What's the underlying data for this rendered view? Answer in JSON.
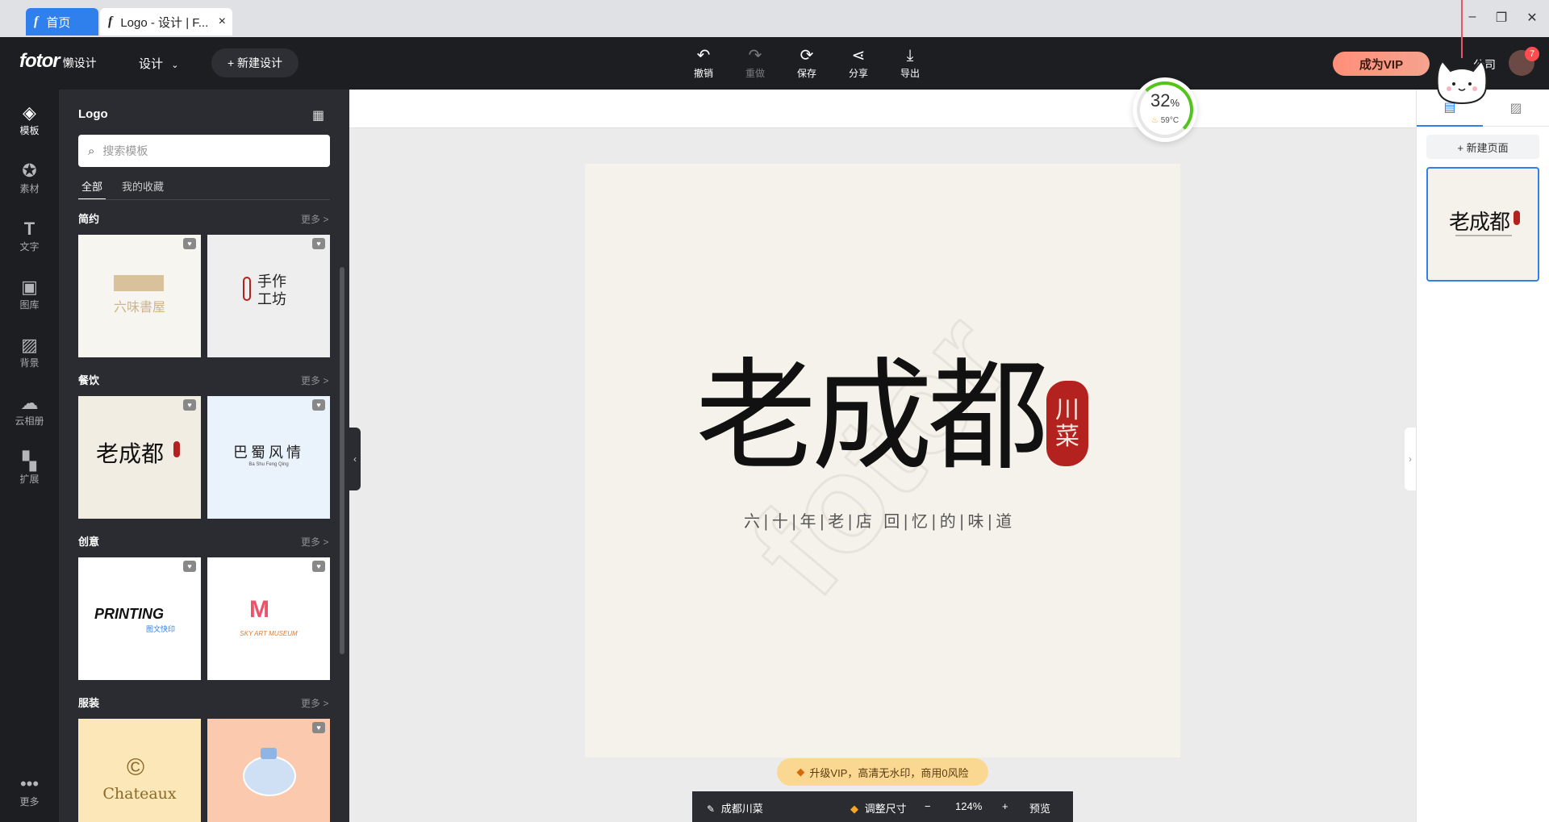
{
  "window": {
    "tabs": [
      {
        "icon": "f",
        "label": "首页"
      },
      {
        "icon": "f",
        "label": "Logo - 设计 | F..."
      }
    ],
    "close_tab": "×",
    "controls": {
      "minimize": "–",
      "restore": "❐",
      "close": "✕"
    }
  },
  "topbar": {
    "brand": "fotor",
    "brand_sub": "懒设计",
    "design_menu": "设计",
    "new_design": "+ 新建设计",
    "tools": [
      {
        "icon": "undo-icon",
        "label": "撤销",
        "disabled": false
      },
      {
        "icon": "redo-icon",
        "label": "重做",
        "disabled": true
      },
      {
        "icon": "save-icon",
        "label": "保存",
        "disabled": false
      },
      {
        "icon": "share-icon",
        "label": "分享",
        "disabled": false
      },
      {
        "icon": "export-icon",
        "label": "导出",
        "disabled": false
      }
    ],
    "vip_button": "成为VIP",
    "company_text": "公司",
    "avatar_badge": "7"
  },
  "rail": [
    {
      "icon": "layers-icon",
      "label": "模板",
      "active": true
    },
    {
      "icon": "star-icon",
      "label": "素材",
      "active": false
    },
    {
      "icon": "text-icon",
      "label": "文字",
      "active": false
    },
    {
      "icon": "image-icon",
      "label": "图库",
      "active": false
    },
    {
      "icon": "background-icon",
      "label": "背景",
      "active": false
    },
    {
      "icon": "cloud-icon",
      "label": "云相册",
      "active": false
    },
    {
      "icon": "extend-icon",
      "label": "扩展",
      "active": false
    },
    {
      "icon": "more-icon",
      "label": "更多",
      "active": false
    }
  ],
  "panel": {
    "title": "Logo",
    "search_placeholder": "搜索模板",
    "subtabs": [
      "全部",
      "我的收藏"
    ],
    "sections": [
      {
        "title": "简约",
        "more": "更多 >",
        "cards": [
          {
            "text": "六味書屋"
          },
          {
            "text": "手作 工坊"
          }
        ]
      },
      {
        "title": "餐饮",
        "more": "更多 >",
        "cards": [
          {
            "text": "老成都"
          },
          {
            "text": "巴蜀风情"
          }
        ]
      },
      {
        "title": "创意",
        "more": "更多 >",
        "cards": [
          {
            "text": "PRINTING"
          },
          {
            "text": "SKY ART MUSEUM"
          }
        ]
      },
      {
        "title": "服装",
        "more": "更多 >",
        "cards": [
          {
            "text": "Chateaux"
          },
          {
            "text": ""
          }
        ]
      }
    ],
    "card_sub": {
      "printing_cn": "图文快印",
      "ba_shu_pinyin": "Ba  Shu  Feng  Qing"
    }
  },
  "canvas": {
    "main_title": "老成都",
    "seal_text": [
      "川",
      "菜"
    ],
    "subtitle": "六|十|年|老|店  回|忆|的|味|道",
    "watermark": "fotor"
  },
  "perf": {
    "percent": "32",
    "percent_sign": "%",
    "temp": "59°C"
  },
  "vip_banner": "升级VIP，高清无水印，商用0风险",
  "bottom_bar": {
    "name": "成都川菜",
    "resize": "调整尺寸",
    "minus": "−",
    "zoom": "124%",
    "plus": "+",
    "preview": "预览"
  },
  "right_panel": {
    "new_page": "+ 新建页面",
    "thumb_title": "老成都"
  },
  "colors": {
    "accent": "#2f80ed",
    "dark_bg": "#1d1e22",
    "panel_bg": "#2b2c31",
    "artboard": "#f5f2eb",
    "seal": "#b3221e",
    "vip": "#ff8f7a"
  }
}
